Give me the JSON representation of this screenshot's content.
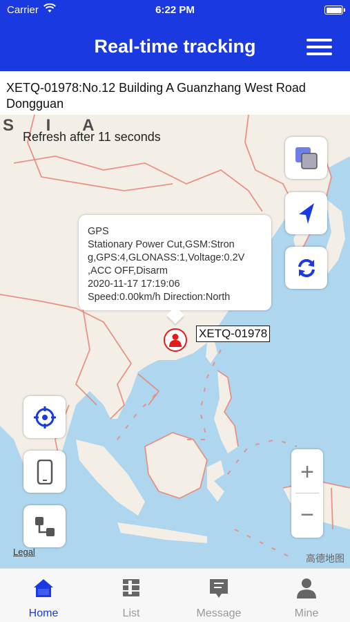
{
  "status_bar": {
    "carrier": "Carrier",
    "time": "6:22 PM"
  },
  "header": {
    "title": "Real-time tracking",
    "menu_icon": "hamburger-menu-icon"
  },
  "address": "XETQ-01978:No.12 Building A Guanzhang West Road Dongguan",
  "map": {
    "region_label": "S I A",
    "refresh_text": "Refresh after 11 seconds",
    "popup": {
      "lines": [
        "GPS",
        "Stationary Power Cut,GSM:Stron",
        "g,GPS:4,GLONASS:1,Voltage:0.2V",
        ",ACC OFF,Disarm",
        "2020-11-17 17:19:06",
        "Speed:0.00km/h Direction:North"
      ]
    },
    "device_label": "XETQ-01978",
    "zoom_in": "+",
    "zoom_out": "−",
    "legal": "Legal",
    "attribution": "高德地图",
    "controls_right": [
      "layers-icon",
      "navigation-arrow-icon",
      "refresh-icon"
    ],
    "controls_left": [
      "locate-target-icon",
      "phone-icon",
      "device-switch-icon"
    ]
  },
  "tabs": [
    {
      "label": "Home",
      "icon": "home-icon",
      "active": true
    },
    {
      "label": "List",
      "icon": "list-icon",
      "active": false
    },
    {
      "label": "Message",
      "icon": "message-icon",
      "active": false
    },
    {
      "label": "Mine",
      "icon": "user-icon",
      "active": false
    }
  ],
  "colors": {
    "primary": "#1a39e0",
    "marker": "#e21b1b",
    "water": "#aed6ee",
    "land": "#f3eee6",
    "border": "#e8897a"
  }
}
